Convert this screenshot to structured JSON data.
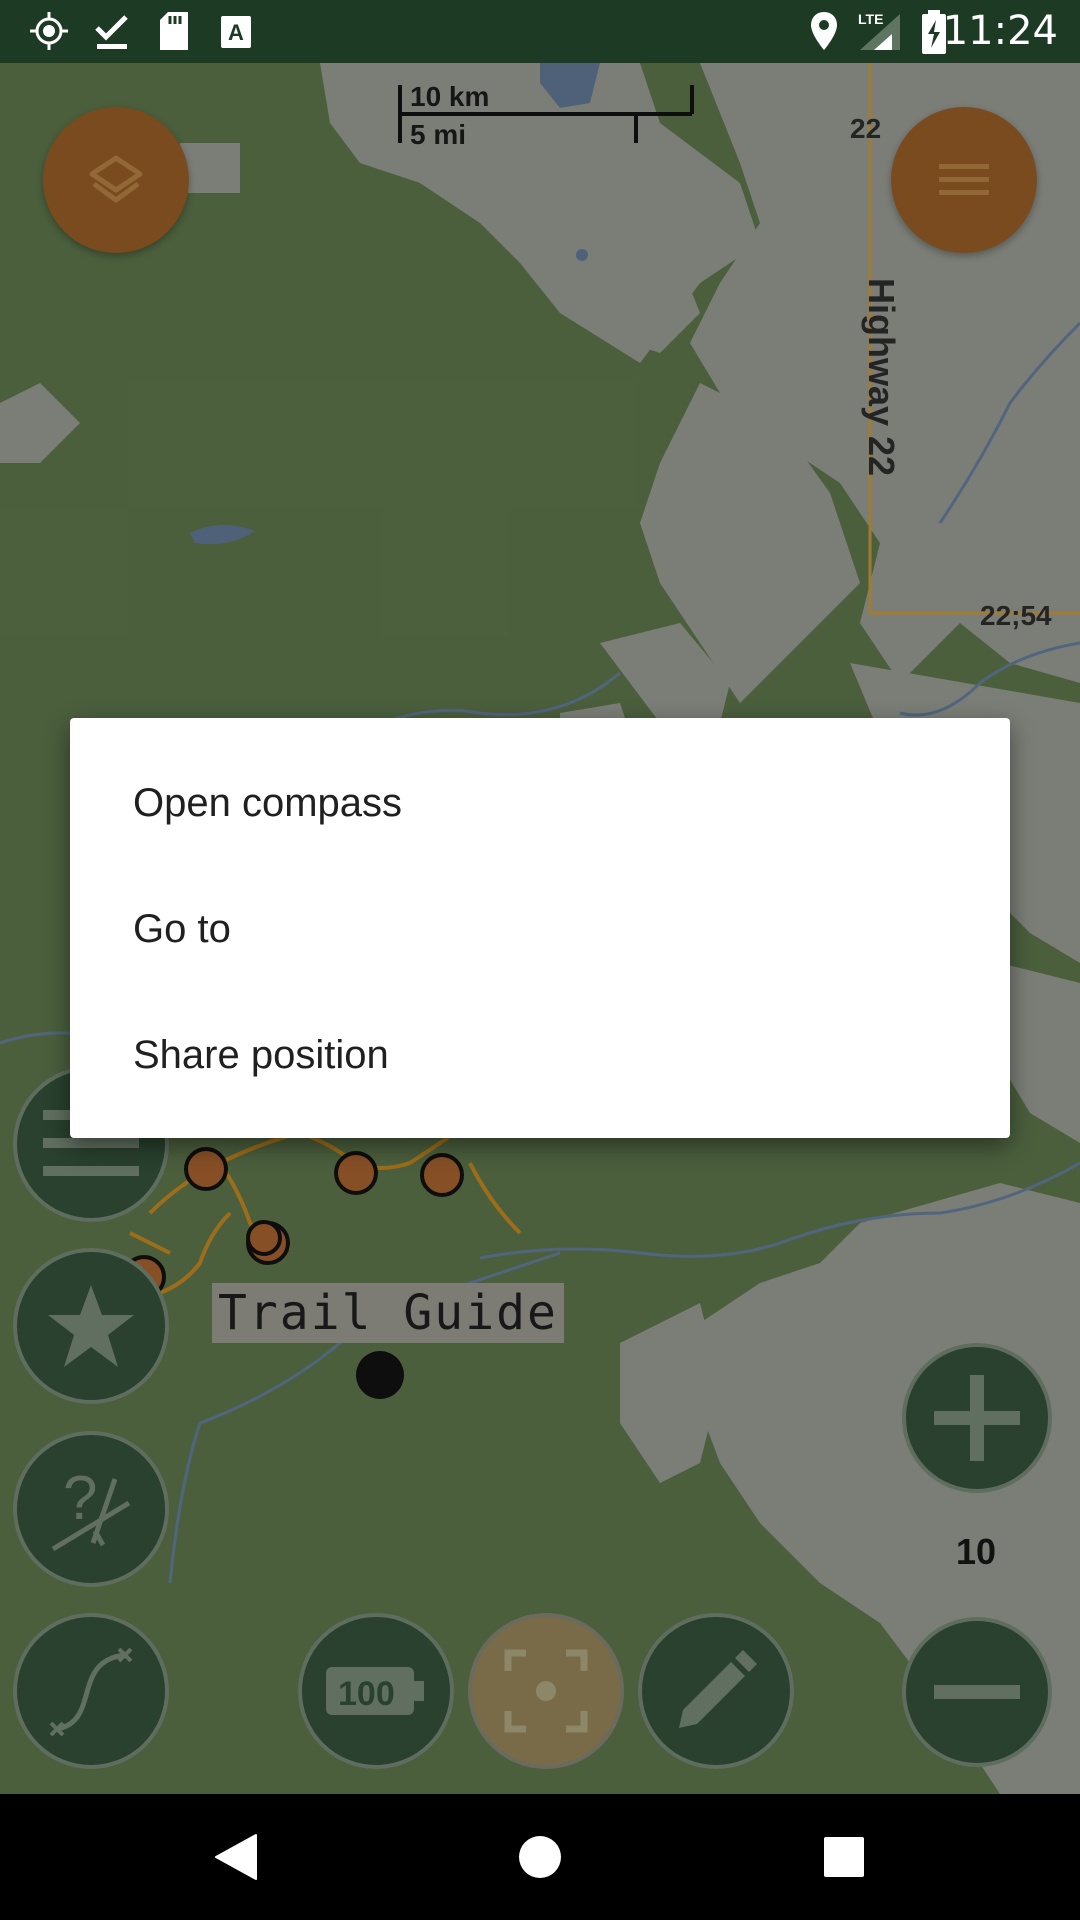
{
  "status_bar": {
    "time": "11:24",
    "network": "LTE",
    "left_icons": [
      "gps-icon",
      "download-done-icon",
      "sd-card-icon",
      "keyboard-a-icon"
    ],
    "right_icons": [
      "location-pin-icon",
      "lte-signal-icon",
      "battery-charging-icon"
    ]
  },
  "map": {
    "scale_km": "10 km",
    "scale_mi": "5 mi",
    "road_labels": {
      "highway_vertical": "Highway 22",
      "route_top": "22",
      "route_junction": "22;54"
    },
    "trail_label": "Trail Guide",
    "zoom_level": "10",
    "battery_level": "100"
  },
  "dialog": {
    "items": [
      {
        "label": "Open compass"
      },
      {
        "label": "Go to"
      },
      {
        "label": "Share position"
      }
    ]
  },
  "colors": {
    "status_bar": "#1d3a24",
    "map_base": "#566d46",
    "fab_orange": "#8a5624",
    "fab_green": "#2f4a35",
    "trail": "#b47d1e"
  }
}
